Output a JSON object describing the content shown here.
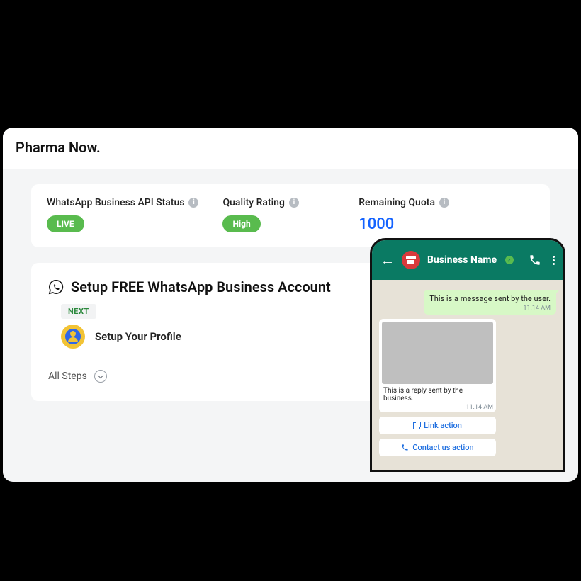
{
  "dashboard": {
    "title": "Pharma Now.",
    "status": {
      "api_label": "WhatsApp Business API Status",
      "api_value": "LIVE",
      "quality_label": "Quality Rating",
      "quality_value": "High",
      "quota_label": "Remaining Quota",
      "quota_value": "1000"
    },
    "setup": {
      "title": "Setup FREE WhatsApp Business Account",
      "next_label": "NEXT",
      "step_label": "Setup Your Profile",
      "all_steps_label": "All Steps"
    }
  },
  "phone": {
    "business_name": "Business Name",
    "user_message": "This is a message sent by the user.",
    "user_time": "11.14 AM",
    "business_reply": "This is a reply sent by the business.",
    "business_time": "11.14 AM",
    "link_action": "Link action",
    "contact_action": "Contact us action"
  },
  "colors": {
    "accent_green": "#59bb4e",
    "wa_header": "#0a7a63",
    "link_blue": "#1463ff"
  }
}
